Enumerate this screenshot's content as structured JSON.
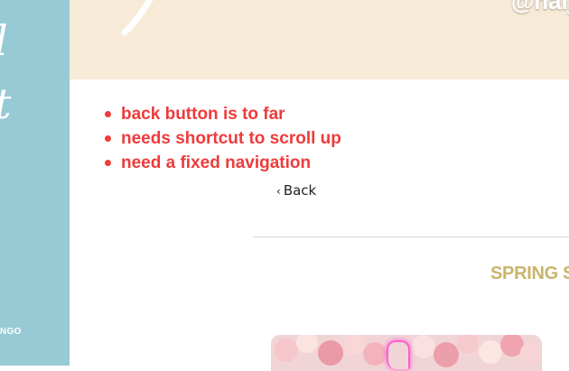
{
  "sidebar": {
    "script_line_1": "l",
    "script_line_2": "t",
    "small_label": "NGO"
  },
  "banner": {
    "handle_text": "@naij"
  },
  "notes": [
    "back button is to far",
    "needs shortcut to scroll up",
    "need a fixed navigation"
  ],
  "navigation": {
    "back_chevron": "‹",
    "back_label": "Back"
  },
  "section": {
    "title": "SPRING S"
  },
  "colors": {
    "sidebar": "#97cad5",
    "banner": "#f7ebd7",
    "note_text": "#ee3b3b",
    "section_title": "#c9b46a",
    "neon": "#ff5fd2"
  }
}
